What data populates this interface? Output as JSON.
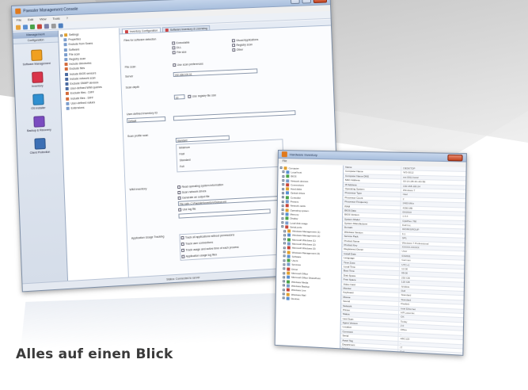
{
  "main_window": {
    "title": "Paessler Management Console",
    "menu": [
      "File",
      "Edit",
      "View",
      "Tools",
      "?"
    ],
    "nav": {
      "header": "Management",
      "sub": "Configuration",
      "items": [
        {
          "label": "Software Management",
          "color": "#f0a020"
        },
        {
          "label": "Inventory",
          "color": "#d9344a"
        },
        {
          "label": "OS Installer",
          "color": "#2f8fd0"
        },
        {
          "label": "Backup & Recovery",
          "color": "#7a4bc0"
        },
        {
          "label": "Client Protection",
          "color": "#3c6fb4"
        }
      ]
    },
    "tree": [
      "Settings",
      "Properties",
      "Exclude from Scans",
      "Software",
      "File scan",
      "Registry scan",
      "Include directories",
      "Exclude files",
      "Include BIOS sensors",
      "Include network scan",
      "Exclude SNMP devices",
      "User-defined WMI queries",
      "Exclude files - DIFF",
      "Include files - DIFF",
      "User-defined values",
      "Extensions"
    ],
    "tabs": [
      "Inventory Configuration",
      "Software Inventory & Licensing"
    ],
    "form": {
      "scan_label": "Files for software detection",
      "checks_left": [
        "Executable",
        "DLL",
        "File size"
      ],
      "checks_right": [
        "Visual Applications",
        "Registry scan",
        "Other"
      ],
      "file_scan_label": "File scan",
      "file_scan_check": "Use scan preferences",
      "server_label": "Server",
      "server_value": "192.168.100.10",
      "depth_label": "Scan depth",
      "depth_value": "10",
      "depth_check": "Use registry file size",
      "user_defined_label": "User-defined Inventory ID",
      "user_defined_value": "Default",
      "scan_profile_label": "Scan profile scan",
      "scan_profile_value": "Standard",
      "profile_options": [
        "Minimum",
        "Fast",
        "Standard",
        "Full"
      ],
      "wmi_label": "WMI inventory",
      "wmi_checks": [
        "Read operating system information",
        "Scan network drives",
        "Generate an output file",
        "Use log file"
      ],
      "wmi_path": "File path: C:\\Paessler\\Inventory\\Output.xml",
      "app_label": "Application Usage Tracking",
      "app_checks": [
        "Track all applications without permissions",
        "Track user connections",
        "Track usage and active time of each process",
        "Application usage log files"
      ]
    },
    "statusbar": "Status: Connected to server"
  },
  "second_window": {
    "title": "Hardware Inventory",
    "menu": [
      "File"
    ],
    "tree": [
      "Computer",
      "Local host",
      "BIOS",
      "Network devices",
      "Connections",
      "Hard disks",
      "Optical drives",
      "Controller",
      "Printers",
      "Network cards",
      "Operating system",
      "Memory",
      "Display",
      "Local disk usage",
      "Serial ports",
      "Windows Management (1)",
      "Windows Management (2)",
      "Microsoft Windows (1)",
      "Microsoft Windows (2)",
      "Microsoft Windows (3)",
      "Windows Management (3)",
      "Software",
      "Users",
      "Services",
      "Driver",
      "Microsoft Office",
      "Microsoft Office SharePoint",
      "Windows Media",
      "Windows Backup",
      "Windows Live",
      "Windows Mail",
      "Devices"
    ],
    "props": [
      [
        "Name",
        "DESKTOP"
      ],
      [
        "Computer Name",
        "WS-0012"
      ],
      [
        "Computer Name DNS",
        "ws-0012.local"
      ],
      [
        "MAC Address",
        "00-1A-2B-3C-4D-5E"
      ],
      [
        "IP Address",
        "192.168.100.24"
      ],
      [
        "Operating System",
        "Windows 7"
      ],
      [
        "Processor Type",
        "Intel"
      ],
      [
        "Processor Count",
        "2"
      ],
      [
        "Processor Frequency",
        "2400 MHz"
      ],
      [
        "RAM",
        "4096 MB"
      ],
      [
        "BIOS Date",
        "06/2010"
      ],
      [
        "BIOS Version",
        "1.0.4"
      ],
      [
        "System Model",
        "OptiPlex 760"
      ],
      [
        "System Manufacturer",
        "Dell Inc."
      ],
      [
        "Domain",
        "WORKGROUP"
      ],
      [
        "Windows Version",
        "6.1"
      ],
      [
        "Service Pack",
        "SP1"
      ],
      [
        "Product Name",
        "Windows 7 Professional"
      ],
      [
        "Product Key",
        "XXXXX-XXXXX"
      ],
      [
        "Registered Owner",
        "User"
      ],
      [
        "Install Date",
        "03/2011"
      ],
      [
        "Language",
        "German"
      ],
      [
        "Time Zone",
        "UTC+1"
      ],
      [
        "Local Time",
        "12:00"
      ],
      [
        "Boot Time",
        "08:00"
      ],
      [
        "Disk Space",
        "250 GB"
      ],
      [
        "Free Space",
        "120 GB"
      ],
      [
        "Video Card",
        "NVIDIA"
      ],
      [
        "Monitor",
        "Dell"
      ],
      [
        "Keyboard",
        "Standard"
      ],
      [
        "Mouse",
        "Standard"
      ],
      [
        "Sound",
        "Realtek"
      ],
      [
        "Network",
        "Intel Ethernet"
      ],
      [
        "Printer",
        "HP LaserJet"
      ],
      [
        "Status",
        "OK"
      ],
      [
        "Last Scan",
        "Today"
      ],
      [
        "Agent Version",
        "2.0"
      ],
      [
        "Location",
        "Office"
      ],
      [
        "Comment",
        "-"
      ],
      [
        "Serial",
        "ABC123"
      ],
      [
        "Asset Tag",
        "-"
      ],
      [
        "Department",
        "IT"
      ],
      [
        "Vendor",
        "Dell"
      ],
      [
        "Warranty",
        "2013"
      ],
      [
        "Notes",
        "-"
      ]
    ]
  },
  "caption": "Alles auf einen Blick"
}
